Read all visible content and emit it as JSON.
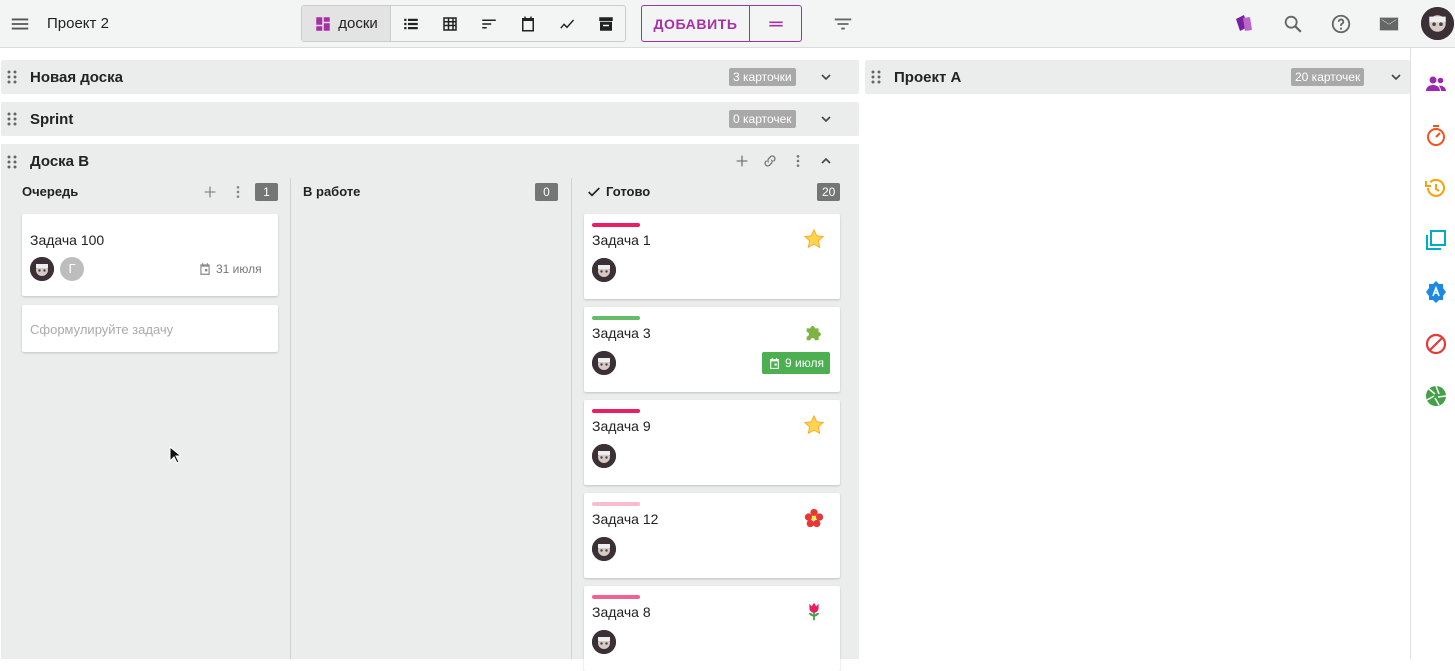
{
  "app": {
    "project_title": "Проект 2"
  },
  "toolbar": {
    "view_boards_label": "доски",
    "add_label": "ДОБАВИТЬ"
  },
  "colors": {
    "accent": "#a630a8",
    "badge_grey": "#a9a9a9",
    "date_green": "#4caf50"
  },
  "boards": [
    {
      "title": "Новая доска",
      "count": "3 карточки"
    },
    {
      "title": "Sprint",
      "count": "0 карточек"
    },
    {
      "title": "Доска B"
    },
    {
      "title": "Проект А",
      "count": "20 карточек"
    }
  ],
  "columns": [
    {
      "title": "Очередь",
      "count": "1"
    },
    {
      "title": "В работе",
      "count": "0"
    },
    {
      "title": "Готово",
      "count": "20"
    }
  ],
  "queue_card": {
    "title": "Задача 100",
    "avatar_letter": "Г",
    "date": "31 июля"
  },
  "new_task_placeholder": "Сформулируйте задачу",
  "done_cards": [
    {
      "title": "Задача 1",
      "label_color": "#e91e63",
      "emoji": "star"
    },
    {
      "title": "Задача 3",
      "label_color": "#66bb6a",
      "emoji": "puzzle",
      "date": "9 июля"
    },
    {
      "title": "Задача 9",
      "label_color": "#e91e63",
      "emoji": "star"
    },
    {
      "title": "Задача 12",
      "label_color": "#f8bbd0",
      "emoji": "flower"
    },
    {
      "title": "Задача 8",
      "label_color": "#f06292",
      "emoji": "tulip"
    }
  ],
  "icons": [
    "menu-icon",
    "dashboard-icon",
    "list-icon",
    "table-icon",
    "sort-icon",
    "calendar-icon",
    "chart-icon",
    "archive-icon",
    "drag-handle-icon",
    "filter-icon",
    "cards-icon",
    "search-icon",
    "help-icon",
    "mail-icon",
    "user-avatar",
    "people-icon",
    "timer-icon",
    "history-icon",
    "layers-icon",
    "badge-icon",
    "block-icon",
    "aperture-icon"
  ]
}
